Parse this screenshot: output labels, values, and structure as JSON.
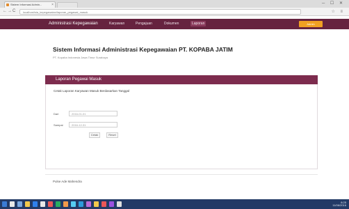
{
  "browser": {
    "tab_title": "Sistem Informasi Admin...",
    "tab_close": "×",
    "window_controls": "─ ☐ ✕",
    "nav_icons": [
      "←",
      "→",
      "C"
    ],
    "url": "localhost/sia_kepegawaian/laporan_pegawai_masuk",
    "toolbar_icons": "☆ ≡"
  },
  "navbar": {
    "brand": "Administrasi Kepegawaian",
    "menu": [
      "Karyawan",
      "Pengajuan",
      "Dokumen",
      "Laporan"
    ],
    "user": "Admin"
  },
  "header": {
    "title": "Sistem Informasi Administrasi Kepegawaian PT. KOPABA JATIM",
    "subtitle": "PT. Kopaba Indonesia Jawa Timur Surabaya"
  },
  "panel": {
    "title": "Laporan Pegawai Masuk",
    "description": "Cetak Laporan Karyawan Masuk Berdasarkan Tanggal",
    "form": {
      "from_label": "Dari",
      "from_value": "2016-01-01",
      "to_label": "Sampai",
      "to_value": "2016-12-31",
      "print_button": "Cetak",
      "reset_button": "Reset"
    }
  },
  "footer": {
    "text": "Pulse Ade Mahendra"
  },
  "taskbar": {
    "tray_time": "8:25",
    "tray_date": "11/06/2016",
    "colors": {
      "bg": "#233a66",
      "navbar": "#66233f",
      "panel_heading": "#7d2c4e",
      "accent": "#f0a023"
    }
  }
}
